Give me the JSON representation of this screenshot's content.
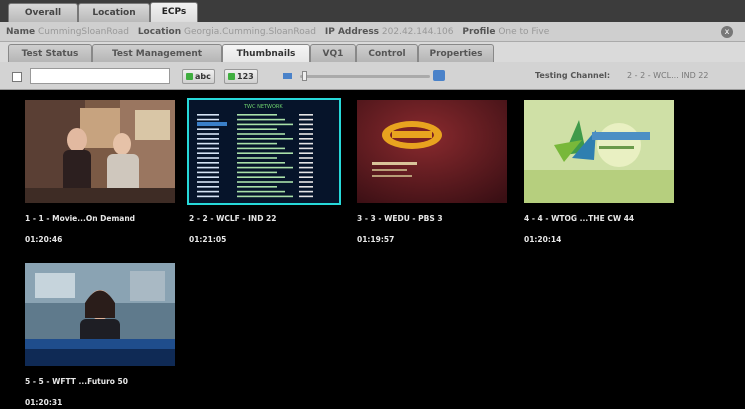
{
  "top_tabs": [
    "Overall",
    "Location",
    "ECPs"
  ],
  "info": {
    "name_label": "Name",
    "name_value": "CummingSloanRoad",
    "location_label": "Location",
    "location_value": "Georgia.Cumming.SloanRoad",
    "ip_label": "IP Address",
    "ip_value": "202.42.144.106",
    "profile_label": "Profile",
    "profile_value": "One to Five",
    "close_symbol": "x"
  },
  "sub_tabs": [
    "Test Status",
    "Test Management",
    "Thumbnails",
    "VQ1",
    "Control",
    "Properties"
  ],
  "toolbar": {
    "search_value": "",
    "button1": "abc",
    "button2": "123",
    "testing_label": "Testing Channel:",
    "testing_value": "2 - 2 - WCL... IND 22"
  },
  "channels": [
    {
      "title": "1 - 1 - Movie...On Demand",
      "time": "01:20:46"
    },
    {
      "title": "2 - 2 - WCLF - IND 22",
      "time": "01:21:05"
    },
    {
      "title": "3 - 3 - WEDU - PBS 3",
      "time": "01:19:57"
    },
    {
      "title": "4 - 4 - WTOG ...THE CW 44",
      "time": "01:20:14"
    },
    {
      "title": "5 - 5 - WFTT ...Futuro 50",
      "time": "01:20:31"
    }
  ],
  "thumb2": {
    "header": "TWC NETWORK"
  },
  "colors": {
    "selection": "#27d9d9",
    "slider_accent": "#4a82c9",
    "button_icon": "#3fae3f"
  }
}
